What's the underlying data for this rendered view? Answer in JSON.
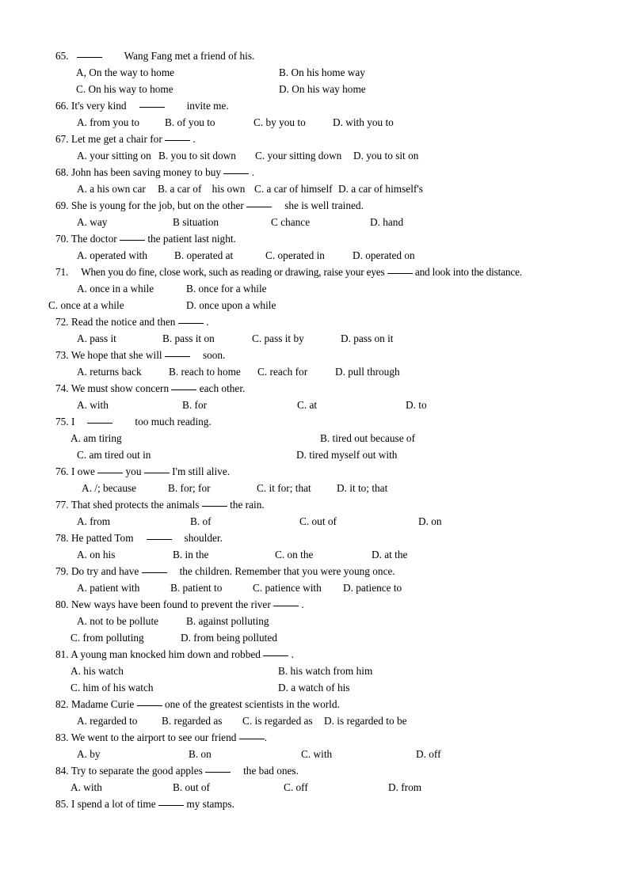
{
  "document": {
    "type": "english-grammar-multiple-choice-worksheet",
    "first_question_number": 65,
    "last_question_number": 85
  },
  "questions": [
    {
      "number": "65.",
      "stem_before": "",
      "blank": "____",
      "stem_after": "Wang Fang met a friend of his.",
      "options": [
        "A, On the way to home",
        "B. On his home way",
        "C. On his way to home",
        "D. On his way home"
      ]
    },
    {
      "number": "66.",
      "stem_before": "It's very kind",
      "blank": "____",
      "stem_after": "invite me.",
      "options": [
        "A. from you to",
        "B. of you to",
        "C. by you to",
        "D. with you to"
      ]
    },
    {
      "number": "67.",
      "stem_before": "Let me get a chair for",
      "blank": "____",
      "stem_after": ".",
      "options": [
        "A. your sitting on",
        "B. you to sit down",
        "C. your sitting down",
        "D. you to sit on"
      ]
    },
    {
      "number": "68.",
      "stem_before": "John has been saving money to buy",
      "blank": "____",
      "stem_after": ".",
      "options": [
        "A. a his own car",
        "B. a car of    his own",
        "C. a car of himself",
        "D. a car of himself's"
      ]
    },
    {
      "number": "69.",
      "stem_before": "She is young for the job, but on the other",
      "blank": "____",
      "stem_after": "she is well trained.",
      "options": [
        "A. way",
        "B situation",
        "C chance",
        "D. hand"
      ]
    },
    {
      "number": "70.",
      "stem_before": "The doctor",
      "blank": "____",
      "stem_after": "the patient last night.",
      "options": [
        "A. operated with",
        "B. operated at",
        "C. operated in",
        "D. operated on"
      ]
    },
    {
      "number": "71.",
      "stem_before": "When you do fine, close work, such as reading or drawing, raise your eyes",
      "blank": "____",
      "stem_after": "and look into the distance.",
      "options": [
        "A. once in a while",
        "B. once for a while",
        "C. once at a while",
        "D. once upon a while"
      ]
    },
    {
      "number": "72.",
      "stem_before": "Read the notice and then",
      "blank": "____",
      "stem_after": ".",
      "options": [
        "A. pass it",
        "B. pass it on",
        "C. pass it by",
        "D. pass on it"
      ]
    },
    {
      "number": "73.",
      "stem_before": "We hope that she will",
      "blank": "____",
      "stem_after": "soon.",
      "options": [
        "A. returns back",
        "B. reach to home",
        "C. reach for",
        "D. pull through"
      ]
    },
    {
      "number": "74.",
      "stem_before": "We must show concern",
      "blank": "____",
      "stem_after": "each other.",
      "options": [
        "A. with",
        "B. for",
        "C. at",
        "D. to"
      ]
    },
    {
      "number": "75.",
      "stem_before": "I",
      "blank": "____",
      "stem_after": "too much reading.",
      "options": [
        "A. am tiring",
        "B. tired out because of",
        "C. am tired out in",
        "D. tired myself out with"
      ]
    },
    {
      "number": "76.",
      "stem_before": "I owe",
      "blank": "____",
      "stem_mid": "you",
      "blank2": "____",
      "stem_after": "I'm still alive.",
      "options": [
        "A. /; because",
        "B. for; for",
        "C. it for; that",
        "D. it to; that"
      ]
    },
    {
      "number": "77.",
      "stem_before": "That shed protects the animals",
      "blank": "____",
      "stem_after": "the rain.",
      "options": [
        "A. from",
        "B. of",
        "C. out of",
        "D. on"
      ]
    },
    {
      "number": "78.",
      "stem_before": "He patted Tom",
      "blank": "____",
      "stem_after": "shoulder.",
      "options": [
        "A. on his",
        "B. in the",
        "C. on the",
        "D. at the"
      ]
    },
    {
      "number": "79.",
      "stem_before": "Do try and have",
      "blank": "____",
      "stem_after": "the children. Remember that you were young once.",
      "options": [
        "A. patient with",
        "B. patient to",
        "C. patience with",
        "D. patience to"
      ]
    },
    {
      "number": "80.",
      "stem_before": "New ways have been found to prevent the river",
      "blank": "____",
      "stem_after": ".",
      "options": [
        "A. not to be pollute",
        "B. against polluting",
        "C. from polluting",
        "D. from being polluted"
      ]
    },
    {
      "number": "81.",
      "stem_before": "A young man knocked him down and robbed",
      "blank": "____",
      "stem_after": ".",
      "options": [
        "A. his watch",
        "B. his watch from him",
        "C. him of his watch",
        "D. a watch of his"
      ]
    },
    {
      "number": "82.",
      "stem_before": "Madame Curie",
      "blank": "____",
      "stem_after": "one of the greatest scientists in the world.",
      "options": [
        "A. regarded to",
        "B. regarded as",
        "C. is regarded as",
        "D. is regarded to be"
      ]
    },
    {
      "number": "83.",
      "stem_before": "We went to the airport to see our friend",
      "blank": "____",
      "stem_after": ".",
      "options": [
        "A. by",
        "B. on",
        "C. with",
        "D. off"
      ]
    },
    {
      "number": "84.",
      "stem_before": "Try to separate the good apples",
      "blank": "____",
      "stem_after": "the bad ones.",
      "options": [
        "A. with",
        "B. out of",
        "C. off",
        "D. from"
      ]
    },
    {
      "number": "85.",
      "stem_before": "I spend a lot of time",
      "blank": "____",
      "stem_after": "my stamps.",
      "options": []
    }
  ]
}
